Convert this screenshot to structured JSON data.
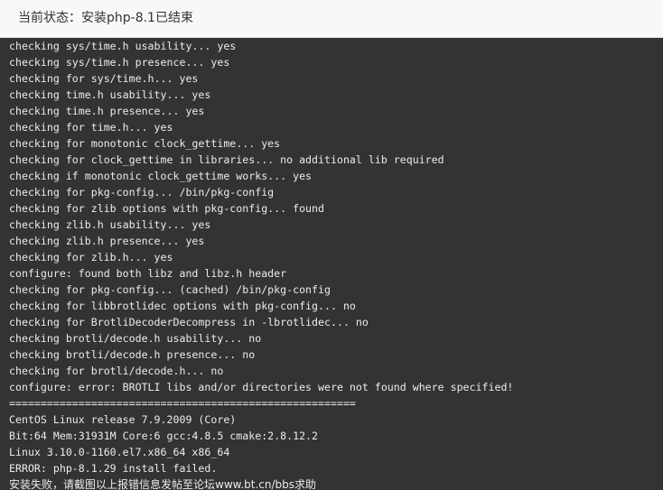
{
  "status": {
    "text": "当前状态：安装php-8.1已结束"
  },
  "console": {
    "lines": [
      "checking sys/time.h usability... yes",
      "checking sys/time.h presence... yes",
      "checking for sys/time.h... yes",
      "checking time.h usability... yes",
      "checking time.h presence... yes",
      "checking for time.h... yes",
      "checking for monotonic clock_gettime... yes",
      "checking for clock_gettime in libraries... no additional lib required",
      "checking if monotonic clock_gettime works... yes",
      "checking for pkg-config... /bin/pkg-config",
      "checking for zlib options with pkg-config... found",
      "checking zlib.h usability... yes",
      "checking zlib.h presence... yes",
      "checking for zlib.h... yes",
      "configure: found both libz and libz.h header",
      "checking for pkg-config... (cached) /bin/pkg-config",
      "checking for libbrotlidec options with pkg-config... no",
      "checking for BrotliDecoderDecompress in -lbrotlidec... no",
      "checking brotli/decode.h usability... no",
      "checking brotli/decode.h presence... no",
      "checking for brotli/decode.h... no",
      "configure: error: BROTLI libs and/or directories were not found where specified!",
      "=======================================================",
      "CentOS Linux release 7.9.2009 (Core)",
      "Bit:64 Mem:31931M Core:6 gcc:4.8.5 cmake:2.8.12.2",
      "Linux 3.10.0-1160.el7.x86_64 x86_64",
      "ERROR: php-8.1.29 install failed.",
      "安装失败，请截图以上报错信息发帖至论坛www.bt.cn/bbs求助"
    ]
  }
}
